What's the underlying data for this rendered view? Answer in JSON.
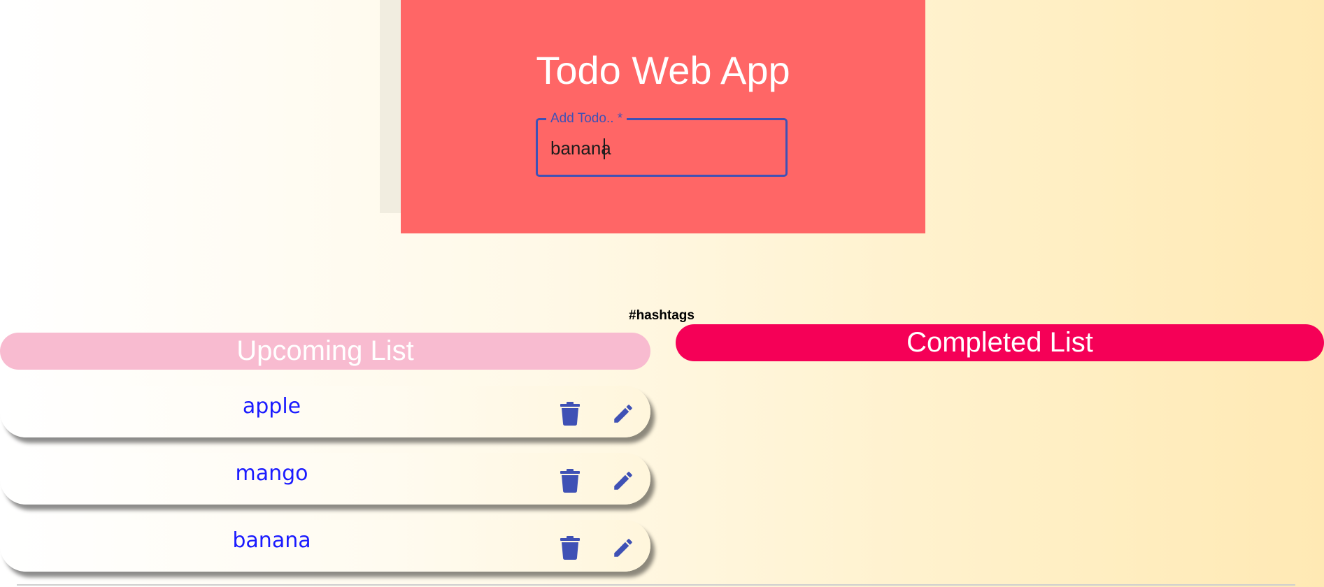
{
  "header": {
    "title": "Todo Web App",
    "input": {
      "label": "Add Todo.. *",
      "value": "banana"
    }
  },
  "hashtags_label": "#hashtags",
  "upcoming": {
    "title": "Upcoming List",
    "items": [
      {
        "text": "apple"
      },
      {
        "text": "mango"
      },
      {
        "text": "banana"
      }
    ]
  },
  "completed": {
    "title": "Completed List",
    "items": []
  },
  "icons": {
    "delete": "trash-icon",
    "edit": "pencil-icon"
  },
  "colors": {
    "header_bg": "#ff6666",
    "accent": "#3f51b5",
    "upcoming_header": "#f8bbd0",
    "completed_header": "#f50057",
    "item_text": "#1a1aff"
  }
}
